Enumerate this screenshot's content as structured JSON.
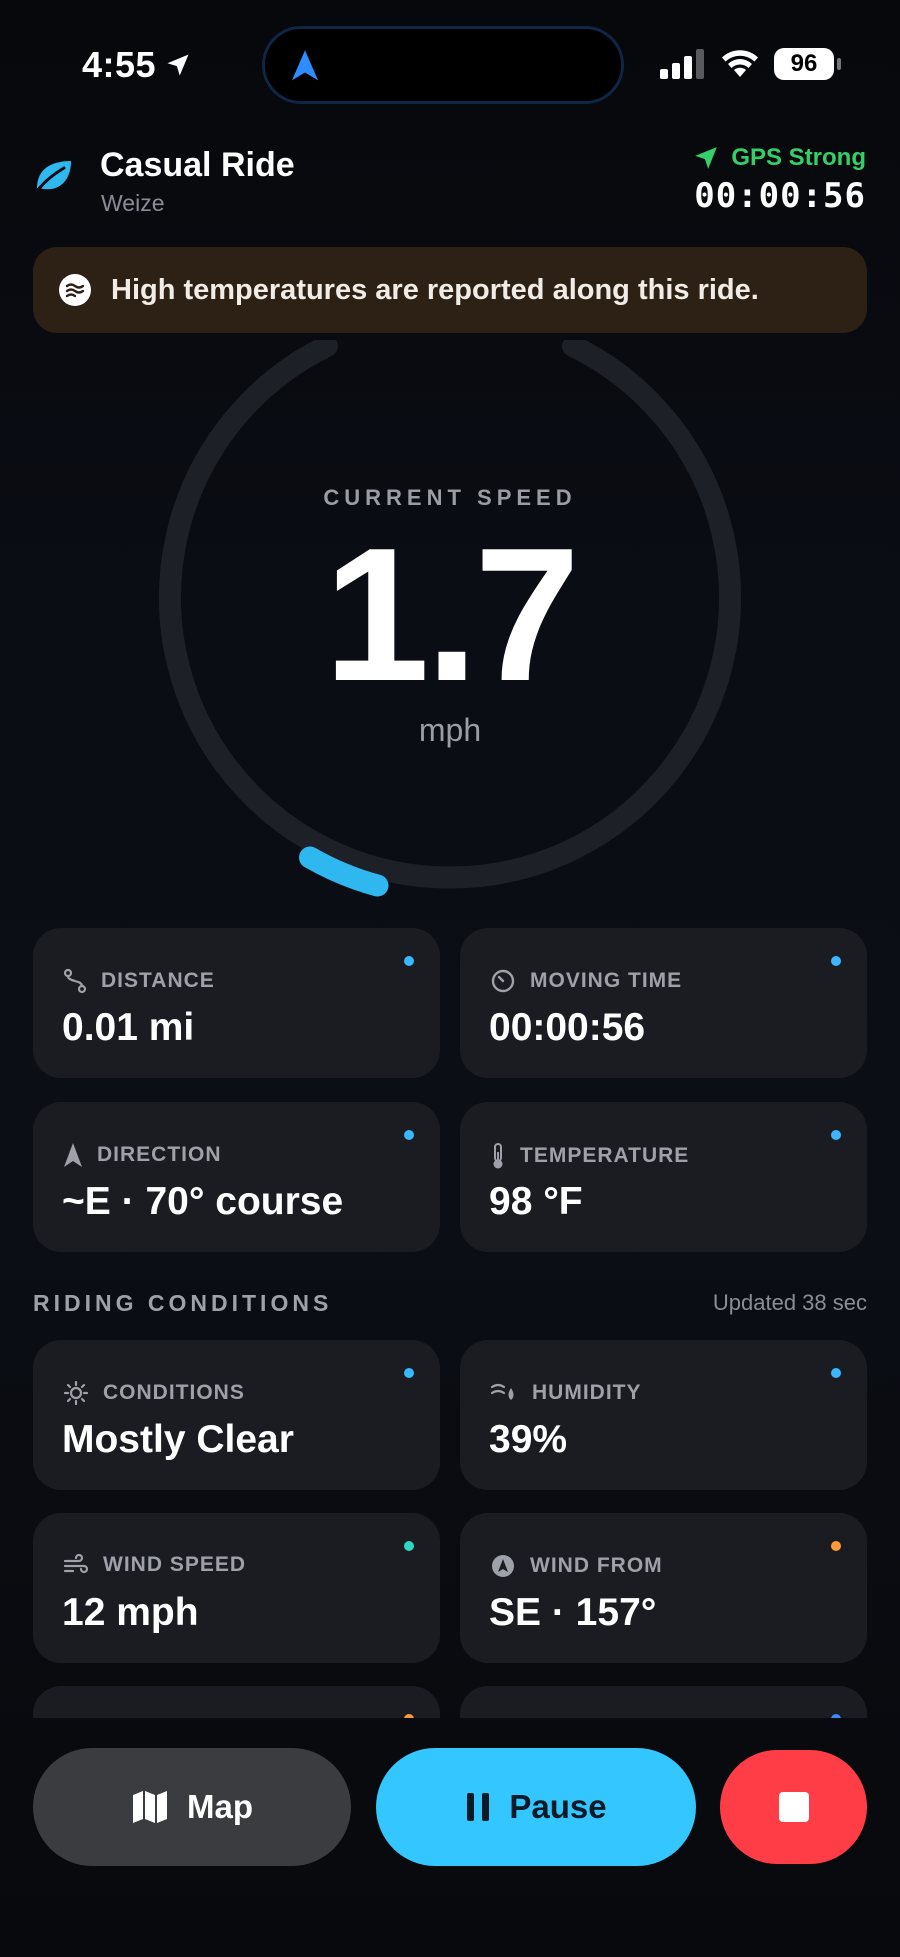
{
  "status_bar": {
    "time": "4:55",
    "battery": "96"
  },
  "header": {
    "title": "Casual Ride",
    "subtitle": "Weize",
    "gps_status": "GPS Strong",
    "elapsed": "00:00:56"
  },
  "alert": {
    "text": "High temperatures are reported along this ride."
  },
  "speed": {
    "label": "CURRENT SPEED",
    "value": "1.7",
    "unit": "mph",
    "gauge_fill_fraction": 0.05
  },
  "metrics": [
    {
      "icon": "route-icon",
      "label": "DISTANCE",
      "value": "0.01 mi",
      "dot_color": "#3ab7ff"
    },
    {
      "icon": "timer-icon",
      "label": "MOVING TIME",
      "value": "00:00:56",
      "dot_color": "#3ab7ff"
    },
    {
      "icon": "navigation-arrow-icon",
      "label": "DIRECTION",
      "value": "~E · 70° course",
      "dot_color": "#3ab7ff"
    },
    {
      "icon": "thermometer-icon",
      "label": "TEMPERATURE",
      "value": "98 °F",
      "dot_color": "#3ab7ff"
    }
  ],
  "conditions_section": {
    "title": "RIDING CONDITIONS",
    "updated": "Updated 38 sec",
    "cards": [
      {
        "icon": "sun-icon",
        "label": "CONDITIONS",
        "value": "Mostly Clear",
        "dot_color": "#3ab7ff"
      },
      {
        "icon": "humidity-icon",
        "label": "HUMIDITY",
        "value": "39%",
        "dot_color": "#3ab7ff"
      },
      {
        "icon": "wind-icon",
        "label": "WIND SPEED",
        "value": "12 mph",
        "dot_color": "#2fd6c4"
      },
      {
        "icon": "compass-icon",
        "label": "WIND FROM",
        "value": "SE · 157°",
        "dot_color": "#ff9a3c"
      }
    ],
    "partial_dots": [
      "#ff9a3c",
      "#3a8bff"
    ]
  },
  "actions": {
    "map_label": "Map",
    "pause_label": "Pause"
  },
  "colors": {
    "accent": "#33c6ff",
    "gps": "#33d06a",
    "stop": "#ff3d46",
    "alert_bg": "#2d2015"
  }
}
